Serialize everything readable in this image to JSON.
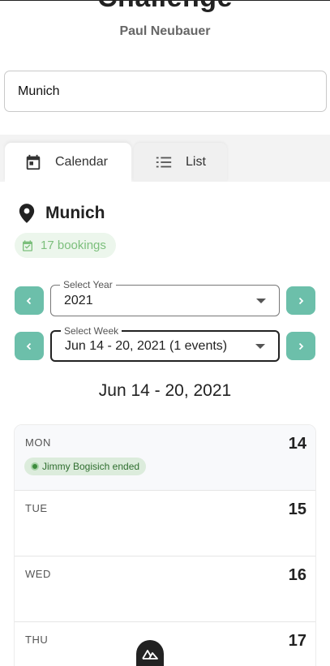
{
  "header": {
    "title": "Challenge",
    "subtitle": "Paul Neubauer"
  },
  "city_input": {
    "value": "Munich"
  },
  "tabs": [
    {
      "label": "Calendar",
      "icon": "calendar-icon",
      "active": true
    },
    {
      "label": "List",
      "icon": "list-icon",
      "active": false
    }
  ],
  "location": {
    "icon": "map-pin-icon",
    "name": "Munich",
    "bookings_label": "17 bookings"
  },
  "year_select": {
    "legend": "Select Year",
    "value": "2021"
  },
  "week_select": {
    "legend": "Select Week",
    "value": "Jun 14 - 20, 2021 (1 events)"
  },
  "week_heading": "Jun 14 - 20, 2021",
  "days": [
    {
      "name": "MON",
      "number": "14",
      "events": [
        "Jimmy Bogisich ended"
      ]
    },
    {
      "name": "TUE",
      "number": "15",
      "events": []
    },
    {
      "name": "WED",
      "number": "16",
      "events": []
    },
    {
      "name": "THU",
      "number": "17",
      "events": []
    }
  ],
  "colors": {
    "accent": "#6cbfaa",
    "chip_bg": "#ecf6ec",
    "chip_text": "#7cbf7c",
    "event_bg": "#dcecdc",
    "event_text": "#2f6e2f"
  },
  "floating_badge": {
    "icon": "nuxt-logo-icon"
  }
}
